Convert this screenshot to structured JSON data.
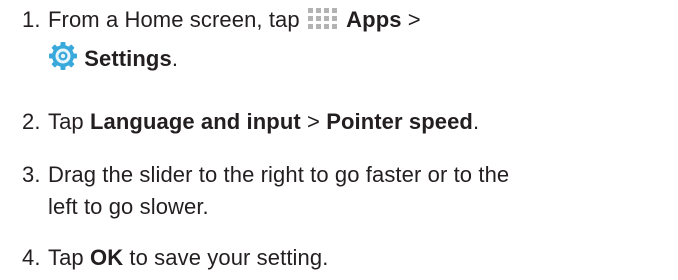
{
  "steps": [
    {
      "num": "1.",
      "text_a": "From a Home screen, tap",
      "apps": "Apps",
      "sep": ">",
      "settings": "Settings",
      "end": ".",
      "icons": [
        "apps-grid-icon",
        "settings-gear-icon"
      ],
      "icon_colors": {
        "apps": "#b3b3b3",
        "settings": "#39a9db"
      }
    },
    {
      "num": "2.",
      "text_a": "Tap",
      "lang": "Language and input",
      "sep": ">",
      "pointer": "Pointer speed",
      "end": "."
    },
    {
      "num": "3.",
      "line1": "Drag the slider to the right to go faster or to the",
      "line2": "left to go slower."
    },
    {
      "num": "4.",
      "text_a": "Tap",
      "ok": "OK",
      "text_b": "to save your setting."
    }
  ]
}
